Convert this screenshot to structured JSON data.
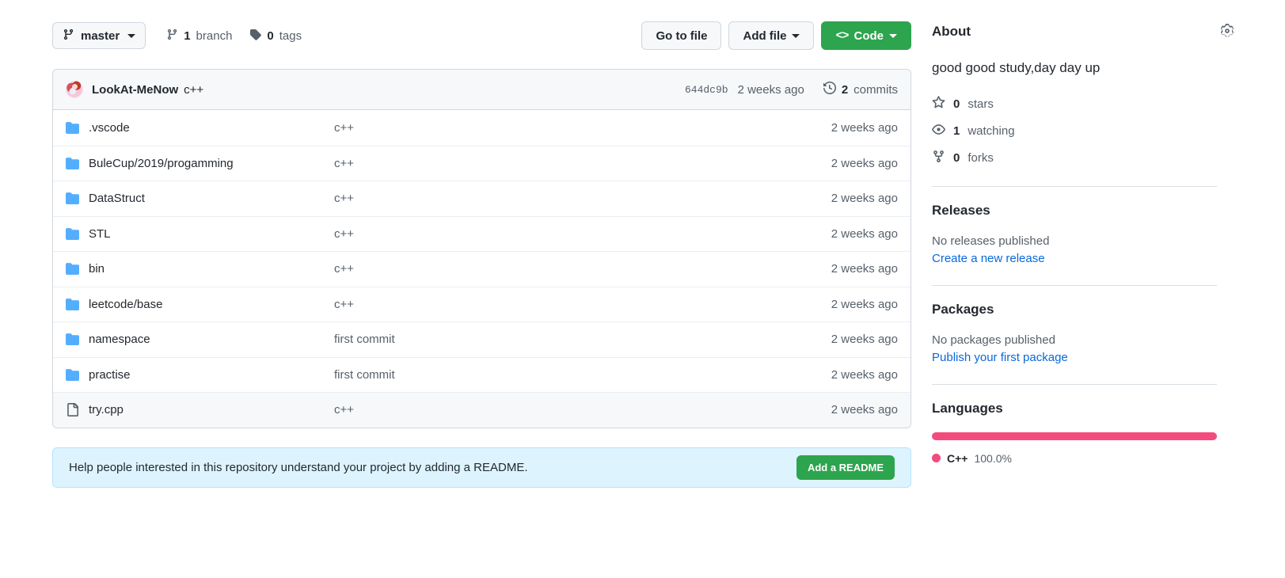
{
  "toolbar": {
    "branch": "master",
    "branch_icon": "branch-icon",
    "branches": {
      "count": "1",
      "label": "branch",
      "icon": "branch-icon"
    },
    "tags": {
      "count": "0",
      "label": "tags",
      "icon": "tag-icon"
    },
    "go_to_file": "Go to file",
    "add_file": "Add file",
    "code": "Code",
    "code_icon": "<>"
  },
  "commit_bar": {
    "author": "LookAt-MeNow",
    "message": "c++",
    "sha": "644dc9b",
    "date": "2 weeks ago",
    "commits_count": "2",
    "commits_label": "commits",
    "history_icon": "history-icon",
    "avatar": "avatar"
  },
  "files": {
    "columns": [
      "name",
      "message",
      "date"
    ],
    "rows": [
      {
        "name": ".vscode",
        "type": "folder",
        "message": "c++",
        "date": "2 weeks ago",
        "highlight": false
      },
      {
        "name": "BuleCup/2019/progamming",
        "type": "folder",
        "message": "c++",
        "date": "2 weeks ago",
        "highlight": false
      },
      {
        "name": "DataStruct",
        "type": "folder",
        "message": "c++",
        "date": "2 weeks ago",
        "highlight": false
      },
      {
        "name": "STL",
        "type": "folder",
        "message": "c++",
        "date": "2 weeks ago",
        "highlight": false
      },
      {
        "name": "bin",
        "type": "folder",
        "message": "c++",
        "date": "2 weeks ago",
        "highlight": false
      },
      {
        "name": "leetcode/base",
        "type": "folder",
        "message": "c++",
        "date": "2 weeks ago",
        "highlight": false
      },
      {
        "name": "namespace",
        "type": "folder",
        "message": "first commit",
        "date": "2 weeks ago",
        "highlight": false
      },
      {
        "name": "practise",
        "type": "folder",
        "message": "first commit",
        "date": "2 weeks ago",
        "highlight": false
      },
      {
        "name": "try.cpp",
        "type": "file",
        "message": "c++",
        "date": "2 weeks ago",
        "highlight": true
      }
    ]
  },
  "readme_banner": {
    "text": "Help people interested in this repository understand your project by adding a README.",
    "button": "Add a README"
  },
  "sidebar": {
    "about": {
      "title": "About",
      "description": "good good study,day day up",
      "settings_icon": "gear-icon"
    },
    "stats": [
      {
        "icon": "star-icon",
        "count": "0",
        "label": "stars"
      },
      {
        "icon": "eye-icon",
        "count": "1",
        "label": "watching"
      },
      {
        "icon": "fork-icon",
        "count": "0",
        "label": "forks"
      }
    ],
    "releases": {
      "title": "Releases",
      "empty": "No releases published",
      "link": "Create a new release"
    },
    "packages": {
      "title": "Packages",
      "empty": "No packages published",
      "link": "Publish your first package"
    },
    "languages": {
      "title": "Languages",
      "items": [
        {
          "name": "C++",
          "percent": "100.0%",
          "value": 100,
          "color": "#f34b7d"
        }
      ]
    }
  },
  "colors": {
    "accent_green": "#2da44e",
    "link_blue": "#0969da",
    "folder_blue": "#54aeff",
    "banner_bg": "#ddf4ff",
    "cpp_pink": "#f34b7d"
  }
}
